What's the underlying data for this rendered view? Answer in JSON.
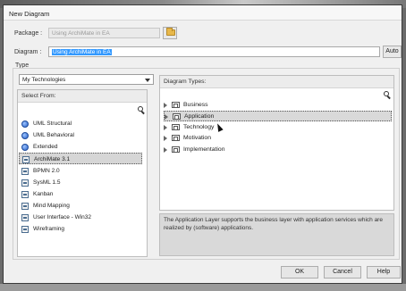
{
  "dialog": {
    "title": "New Diagram"
  },
  "package": {
    "label": "Package :",
    "value": "Using ArchiMate in EA"
  },
  "diagram": {
    "label": "Diagram :",
    "value": "Using ArchiMate in EA",
    "auto_label": "Auto"
  },
  "type": {
    "label": "Type",
    "selected": "My Technologies"
  },
  "select_from": {
    "header": "Select From:",
    "items": [
      {
        "label": "UML Structural",
        "icon": "uml-circle-icon"
      },
      {
        "label": "UML Behavioral",
        "icon": "uml-circle-icon"
      },
      {
        "label": "Extended",
        "icon": "uml-circle-icon"
      },
      {
        "label": "ArchiMate 3.1",
        "icon": "technology-icon",
        "selected": true
      },
      {
        "label": "BPMN 2.0",
        "icon": "technology-icon"
      },
      {
        "label": "SysML 1.5",
        "icon": "technology-icon"
      },
      {
        "label": "Kanban",
        "icon": "technology-icon"
      },
      {
        "label": "Mind Mapping",
        "icon": "technology-icon"
      },
      {
        "label": "User Interface - Win32",
        "icon": "technology-icon"
      },
      {
        "label": "Wireframing",
        "icon": "technology-icon"
      }
    ]
  },
  "diagram_types": {
    "header": "Diagram Types:",
    "items": [
      {
        "label": "Business"
      },
      {
        "label": "Application",
        "selected": true
      },
      {
        "label": "Technology"
      },
      {
        "label": "Motivation"
      },
      {
        "label": "Implementation"
      }
    ]
  },
  "description": "The Application Layer supports the business layer with application services which are realized by (software) applications.",
  "buttons": {
    "ok": "OK",
    "cancel": "Cancel",
    "help": "Help"
  }
}
